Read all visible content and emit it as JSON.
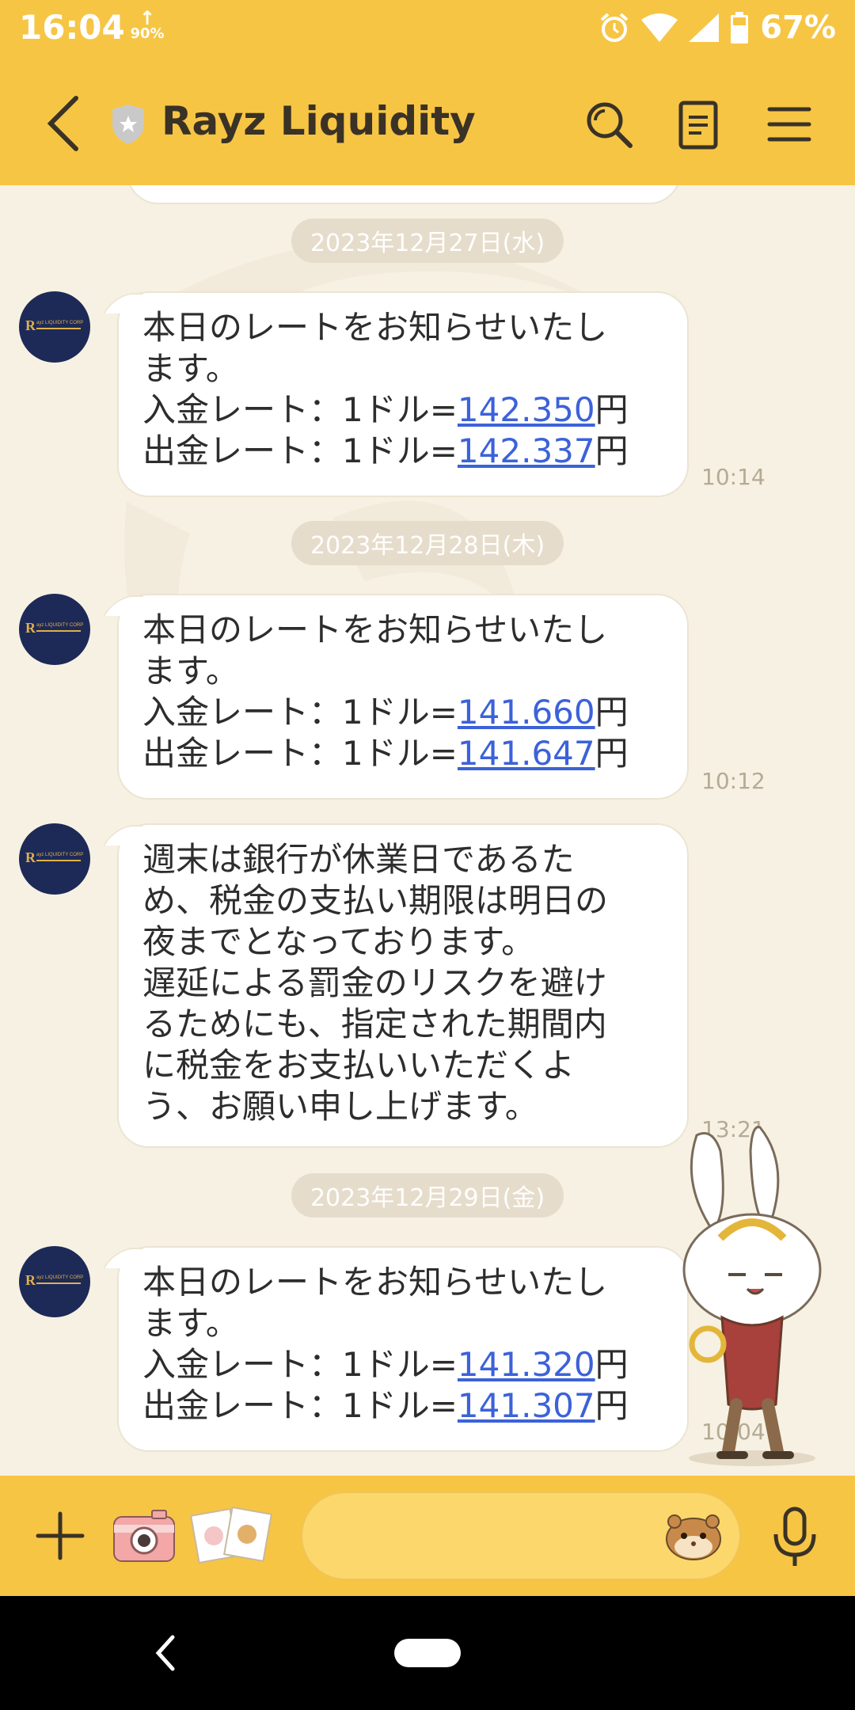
{
  "status_bar": {
    "time": "16:04",
    "data_percent": "90%",
    "battery": "67%",
    "icons": [
      "data-arrow-icon",
      "alarm-icon",
      "wifi-icon",
      "signal-icon",
      "battery-icon"
    ]
  },
  "header": {
    "title": "Rayz Liquidity",
    "icons": [
      "back-arrow-icon",
      "shield-icon",
      "search-icon",
      "notes-icon",
      "menu-icon"
    ]
  },
  "messages": [
    {
      "date": "2023年12月27日(水)",
      "lines": [
        {
          "text": "本日のレートをお知らせいたし"
        },
        {
          "text": "ます。"
        },
        {
          "prefix": "入金レート：1ドル=",
          "value": "142.350",
          "suffix": "円"
        },
        {
          "prefix": "出金レート：1ドル=",
          "value": "142.337",
          "suffix": "円"
        }
      ],
      "time": "10:14"
    },
    {
      "date": "2023年12月28日(木)",
      "lines": [
        {
          "text": "本日のレートをお知らせいたし"
        },
        {
          "text": "ます。"
        },
        {
          "prefix": "入金レート：1ドル=",
          "value": "141.660",
          "suffix": "円"
        },
        {
          "prefix": "出金レート：1ドル=",
          "value": "141.647",
          "suffix": "円"
        }
      ],
      "time": "10:12"
    },
    {
      "lines": [
        {
          "text": "週末は銀行が休業日であるた"
        },
        {
          "text": "め、税金の支払い期限は明日の"
        },
        {
          "text": "夜までとなっております。"
        },
        {
          "text": "遅延による罰金のリスクを避け"
        },
        {
          "text": "るためにも、指定された期間内"
        },
        {
          "text": "に税金をお支払いいただくよ"
        },
        {
          "text": "う、お願い申し上げます。"
        }
      ],
      "time": "13:21"
    },
    {
      "date": "2023年12月29日(金)",
      "lines": [
        {
          "text": "本日のレートをお知らせいたし"
        },
        {
          "text": "ます。"
        },
        {
          "prefix": "入金レート：1ドル=",
          "value": "141.320",
          "suffix": "円"
        },
        {
          "prefix": "出金レート：1ドル=",
          "value": "141.307",
          "suffix": "円"
        }
      ],
      "time": "10:04"
    }
  ],
  "avatar": {
    "logo_letter": "R",
    "logo_text": "ayz LIQUIDITY CORP"
  },
  "input_bar": {
    "placeholder": "",
    "icons": [
      "plus-icon",
      "camera-icon",
      "album-icon",
      "hamster-emoji-icon",
      "mic-icon"
    ]
  },
  "nav_bar": {
    "icons": [
      "nav-back-icon",
      "home-pill-icon"
    ]
  },
  "colors": {
    "header": "#f7c544",
    "chat_bg": "#f7f1e3",
    "link": "#3c62d9",
    "date_pill": "#e6dccb"
  }
}
